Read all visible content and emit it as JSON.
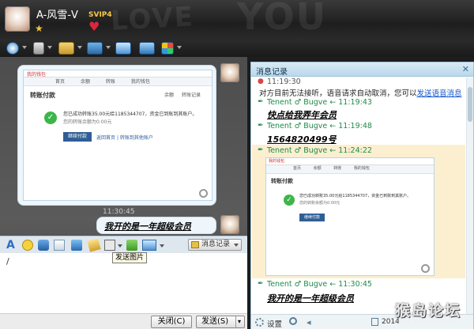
{
  "window": {
    "username": "A-风雪-V",
    "vip_label": "SVIP4",
    "bg_words": [
      "LOVE",
      "YOU"
    ]
  },
  "toolbar": {
    "icons": [
      "video-call-icon",
      "voice-call-icon",
      "file-transfer-icon",
      "remote-desktop-icon",
      "screen-share-icon",
      "create-group-icon",
      "apps-icon"
    ]
  },
  "chat": {
    "screenshot_preview": {
      "browser_tab": "我的钱包",
      "tab_labels": [
        "余额",
        "转账记录"
      ],
      "nav_items": [
        "首页",
        "余额",
        "转账",
        "我的钱包"
      ],
      "header": "转账付款",
      "success_line1": "您已成功转账35.00元给1185344707，资金已到账到其账户。",
      "success_line2": "您的转账余额为0.00元",
      "pay_button": "继续付款",
      "links": [
        "返回首页",
        "|",
        "转账到其他账户"
      ]
    },
    "timestamp": "11:30:45",
    "outgoing_message": "我开的是一年超级会员"
  },
  "chat_toolbar": {
    "tooltip": "发送图片",
    "history_button": "消息记录"
  },
  "input": {
    "value": "/"
  },
  "bottom": {
    "close_button": "关闭(C)",
    "send_button": "发送(S)"
  },
  "history": {
    "title": "消息记录",
    "entries": [
      {
        "meta": "11:19:30",
        "text": "对方目前无法接听，语音请求自动取消，您可以",
        "link": "发送语音消息"
      },
      {
        "meta": "Tenent ♂ Bugve ← 11:19:43",
        "bold": "快点给我弄年会员"
      },
      {
        "meta": "Tenent ♂ Bugve ← 11:19:48",
        "bold": "1564820499号"
      },
      {
        "meta": "Tenent ♂ Bugve ← 11:24:22"
      },
      {
        "meta": "Tenent ♂ Bugve ← 11:30:45",
        "bold": "我开的是一年超级会员"
      }
    ],
    "bottom_settings": "设置",
    "date_fragment": "2014"
  },
  "watermark": {
    "title": "猴岛论坛",
    "url": "bbs.houdao.com"
  }
}
